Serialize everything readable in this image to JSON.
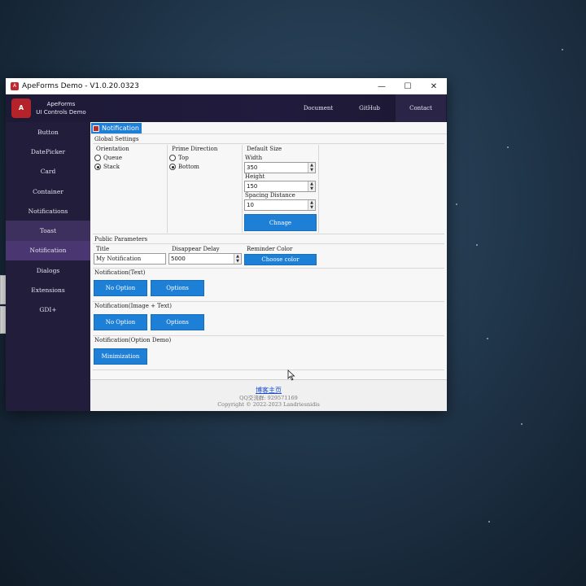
{
  "window": {
    "title": "ApeForms Demo - V1.0.20.0323",
    "min_glyph": "—",
    "max_glyph": "☐",
    "close_glyph": "✕"
  },
  "header": {
    "brand_line1": "ApeForms",
    "brand_line2": "UI Controls Demo",
    "nav": [
      "Document",
      "GitHub",
      "Contact"
    ]
  },
  "sidebar": {
    "items": [
      "Button",
      "DatePicker",
      "Card",
      "Container",
      "Notifications",
      "Toast",
      "Notification",
      "Dialogs",
      "Extensions",
      "GDI+"
    ]
  },
  "tab": {
    "label": "Notification"
  },
  "global": {
    "heading": "Global Settings",
    "orientation_label": "Orientation",
    "orientation_options": [
      "Queue",
      "Stack"
    ],
    "direction_label": "Prime Direction",
    "direction_options": [
      "Top",
      "Bottom"
    ],
    "size_label": "Default Size",
    "width_label": "Width",
    "width_value": "350",
    "height_label": "Height",
    "height_value": "150",
    "spacing_label": "Spacing Distance",
    "spacing_value": "10",
    "change_button": "Chnage"
  },
  "public": {
    "heading": "Public Parameters",
    "title_label": "Title",
    "title_value": "My Notification",
    "delay_label": "Disappear Delay",
    "delay_value": "5000",
    "color_label": "Reminder Color",
    "color_button": "Choose color"
  },
  "sections": {
    "text_heading": "Notification(Text)",
    "image_heading": "Notification(Image + Text)",
    "option_heading": "Notification(Option Demo)",
    "no_option": "No Option",
    "options": "Options",
    "minimization": "Minimization"
  },
  "footer": {
    "link": "博客主页",
    "qq": "QQ交流群: 929571169",
    "copyright": "Copyright © 2022-2023 Landriesnidis"
  },
  "colors": {
    "accent": "#1e7fd6",
    "sidebar_bg": "#221d3b",
    "header_bg": "#1d1a36"
  }
}
